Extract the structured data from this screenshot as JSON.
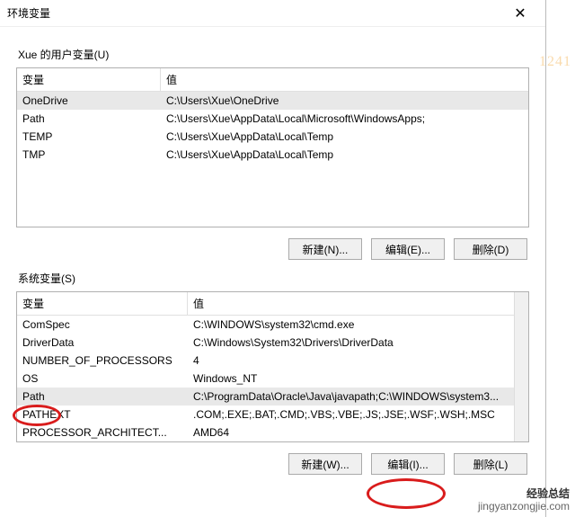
{
  "dialog": {
    "title": "环境变量",
    "close": "✕"
  },
  "userSection": {
    "label": "Xue 的用户变量(U)",
    "headers": {
      "var": "变量",
      "val": "值"
    },
    "rows": [
      {
        "var": "OneDrive",
        "val": "C:\\Users\\Xue\\OneDrive",
        "selected": true
      },
      {
        "var": "Path",
        "val": "C:\\Users\\Xue\\AppData\\Local\\Microsoft\\WindowsApps;"
      },
      {
        "var": "TEMP",
        "val": "C:\\Users\\Xue\\AppData\\Local\\Temp"
      },
      {
        "var": "TMP",
        "val": "C:\\Users\\Xue\\AppData\\Local\\Temp"
      }
    ],
    "buttons": {
      "new": "新建(N)...",
      "edit": "编辑(E)...",
      "delete": "删除(D)"
    }
  },
  "sysSection": {
    "label": "系统变量(S)",
    "headers": {
      "var": "变量",
      "val": "值"
    },
    "rows": [
      {
        "var": "ComSpec",
        "val": "C:\\WINDOWS\\system32\\cmd.exe"
      },
      {
        "var": "DriverData",
        "val": "C:\\Windows\\System32\\Drivers\\DriverData"
      },
      {
        "var": "NUMBER_OF_PROCESSORS",
        "val": "4"
      },
      {
        "var": "OS",
        "val": "Windows_NT"
      },
      {
        "var": "Path",
        "val": "C:\\ProgramData\\Oracle\\Java\\javapath;C:\\WINDOWS\\system3...",
        "selected": true
      },
      {
        "var": "PATHEXT",
        "val": ".COM;.EXE;.BAT;.CMD;.VBS;.VBE;.JS;.JSE;.WSF;.WSH;.MSC"
      },
      {
        "var": "PROCESSOR_ARCHITECT...",
        "val": "AMD64"
      }
    ],
    "buttons": {
      "new": "新建(W)...",
      "edit": "编辑(I)...",
      "delete": "删除(L)"
    }
  },
  "watermark": {
    "code": "1241",
    "brand": "经验总结",
    "url": "jingyanzongjie.com"
  }
}
